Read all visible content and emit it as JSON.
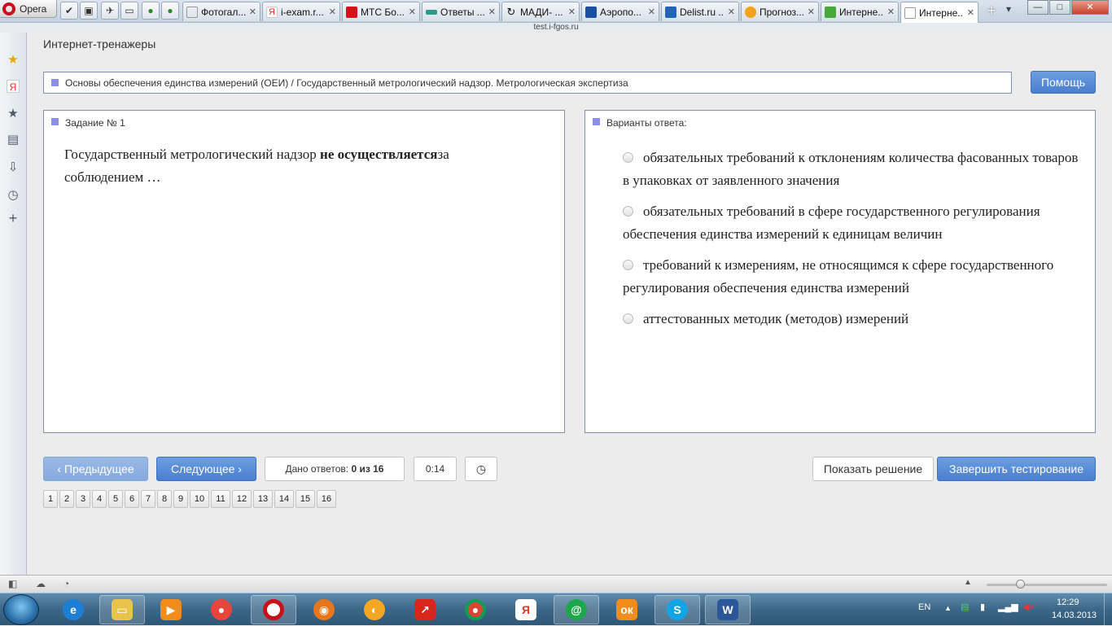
{
  "browser": {
    "menu_label": "Opera",
    "tabs": [
      {
        "title": "Фотогал...",
        "fav_color": "#ffffff"
      },
      {
        "title": "i-exam.r...",
        "fav_color": "#e8302a"
      },
      {
        "title": "МТС Бо...",
        "fav_color": "#d3131b"
      },
      {
        "title": "Ответы ...",
        "fav_color": "#2f9a8a"
      },
      {
        "title": "МАДИ- ...",
        "fav_color": "#ffffff"
      },
      {
        "title": "Аэропо...",
        "fav_color": "#1a4fa3"
      },
      {
        "title": "Delist.ru ...",
        "fav_color": "#2264b8"
      },
      {
        "title": "Прогноз...",
        "fav_color": "#f2a21b"
      },
      {
        "title": "Интерне...",
        "fav_color": "#48a83c"
      },
      {
        "title": "Интерне...",
        "fav_color": "#ffffff",
        "active": true
      }
    ],
    "url": "test.i-fgos.ru",
    "window_controls": {
      "minimize": "—",
      "maximize": "□",
      "close": "✕"
    }
  },
  "page": {
    "site_title": "Интернет-тренажеры",
    "topic": "Основы обеспечения единства измерений (ОЕИ) / Государственный метрологический надзор. Метрологическая экспертиза",
    "help_label": "Помощь",
    "task": {
      "header": "Задание № 1",
      "text_before": "Государственный метрологический надзор ",
      "text_bold": "не осуществляется",
      "text_after": "за соблюдением …"
    },
    "answers": {
      "header": "Варианты ответа:",
      "options": [
        "обязательных требований к отклонениям количества фасованных товаров в упаковках от заявленного значения",
        "обязательных требований в сфере государственного регулирования обеспечения единства измерений к единицам величин",
        "требований к измерениям, не относящимся к сфере государственного регулирования обеспечения единства измерений",
        "аттестованных методик (методов) измерений"
      ]
    },
    "controls": {
      "prev_label": "Предыдущее",
      "next_label": "Следующее",
      "answered_label": "Дано ответов:",
      "answered_value": "0 из 16",
      "timer": "0:14",
      "show_solution_label": "Показать решение",
      "finish_label": "Завершить тестирование"
    },
    "pages": [
      "1",
      "2",
      "3",
      "4",
      "5",
      "6",
      "7",
      "8",
      "9",
      "10",
      "11",
      "12",
      "13",
      "14",
      "15",
      "16"
    ]
  },
  "taskbar": {
    "lang": "EN",
    "time": "12:29",
    "date": "14.03.2013"
  },
  "colors": {
    "accent_blue": "#4a7ed0",
    "panel_border": "#8090b8",
    "bullet": "#8a8ee6"
  }
}
